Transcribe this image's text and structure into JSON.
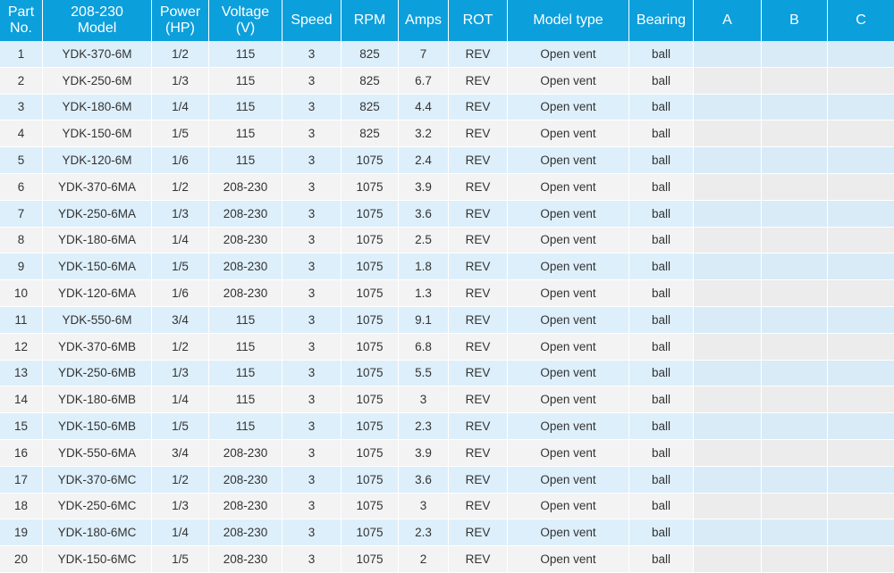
{
  "table": {
    "headers": [
      "Part\nNo.",
      "208-230\nModel",
      "Power\n(HP)",
      "Voltage\n(V)",
      "Speed",
      "RPM",
      "Amps",
      "ROT",
      "Model type",
      "Bearing",
      "A",
      "B",
      "C"
    ],
    "rows": [
      [
        "1",
        "YDK-370-6M",
        "1/2",
        "115",
        "3",
        "825",
        "7",
        "REV",
        "Open vent",
        "ball",
        "",
        "",
        ""
      ],
      [
        "2",
        "YDK-250-6M",
        "1/3",
        "115",
        "3",
        "825",
        "6.7",
        "REV",
        "Open vent",
        "ball",
        "",
        "",
        ""
      ],
      [
        "3",
        "YDK-180-6M",
        "1/4",
        "115",
        "3",
        "825",
        "4.4",
        "REV",
        "Open vent",
        "ball",
        "",
        "",
        ""
      ],
      [
        "4",
        "YDK-150-6M",
        "1/5",
        "115",
        "3",
        "825",
        "3.2",
        "REV",
        "Open vent",
        "ball",
        "",
        "",
        ""
      ],
      [
        "5",
        "YDK-120-6M",
        "1/6",
        "115",
        "3",
        "1075",
        "2.4",
        "REV",
        "Open vent",
        "ball",
        "",
        "",
        ""
      ],
      [
        "6",
        "YDK-370-6MA",
        "1/2",
        "208-230",
        "3",
        "1075",
        "3.9",
        "REV",
        "Open vent",
        "ball",
        "",
        "",
        ""
      ],
      [
        "7",
        "YDK-250-6MA",
        "1/3",
        "208-230",
        "3",
        "1075",
        "3.6",
        "REV",
        "Open vent",
        "ball",
        "",
        "",
        ""
      ],
      [
        "8",
        "YDK-180-6MA",
        "1/4",
        "208-230",
        "3",
        "1075",
        "2.5",
        "REV",
        "Open vent",
        "ball",
        "",
        "",
        ""
      ],
      [
        "9",
        "YDK-150-6MA",
        "1/5",
        "208-230",
        "3",
        "1075",
        "1.8",
        "REV",
        "Open vent",
        "ball",
        "",
        "",
        ""
      ],
      [
        "10",
        "YDK-120-6MA",
        "1/6",
        "208-230",
        "3",
        "1075",
        "1.3",
        "REV",
        "Open vent",
        "ball",
        "",
        "",
        ""
      ],
      [
        "11",
        "YDK-550-6M",
        "3/4",
        "115",
        "3",
        "1075",
        "9.1",
        "REV",
        "Open vent",
        "ball",
        "",
        "",
        ""
      ],
      [
        "12",
        "YDK-370-6MB",
        "1/2",
        "115",
        "3",
        "1075",
        "6.8",
        "REV",
        "Open vent",
        "ball",
        "",
        "",
        ""
      ],
      [
        "13",
        "YDK-250-6MB",
        "1/3",
        "115",
        "3",
        "1075",
        "5.5",
        "REV",
        "Open vent",
        "ball",
        "",
        "",
        ""
      ],
      [
        "14",
        "YDK-180-6MB",
        "1/4",
        "115",
        "3",
        "1075",
        "3",
        "REV",
        "Open vent",
        "ball",
        "",
        "",
        ""
      ],
      [
        "15",
        "YDK-150-6MB",
        "1/5",
        "115",
        "3",
        "1075",
        "2.3",
        "REV",
        "Open vent",
        "ball",
        "",
        "",
        ""
      ],
      [
        "16",
        "YDK-550-6MA",
        "3/4",
        "208-230",
        "3",
        "1075",
        "3.9",
        "REV",
        "Open vent",
        "ball",
        "",
        "",
        ""
      ],
      [
        "17",
        "YDK-370-6MC",
        "1/2",
        "208-230",
        "3",
        "1075",
        "3.6",
        "REV",
        "Open vent",
        "ball",
        "",
        "",
        ""
      ],
      [
        "18",
        "YDK-250-6MC",
        "1/3",
        "208-230",
        "3",
        "1075",
        "3",
        "REV",
        "Open vent",
        "ball",
        "",
        "",
        ""
      ],
      [
        "19",
        "YDK-180-6MC",
        "1/4",
        "208-230",
        "3",
        "1075",
        "2.3",
        "REV",
        "Open vent",
        "ball",
        "",
        "",
        ""
      ],
      [
        "20",
        "YDK-150-6MC",
        "1/5",
        "208-230",
        "3",
        "1075",
        "2",
        "REV",
        "Open vent",
        "ball",
        "",
        "",
        ""
      ]
    ]
  },
  "colors": {
    "header_background": "#0b9fdc",
    "header_text": "#ffffff",
    "row_odd": "#ddeffb",
    "row_even": "#f3f3f3",
    "cell_text": "#333333"
  }
}
